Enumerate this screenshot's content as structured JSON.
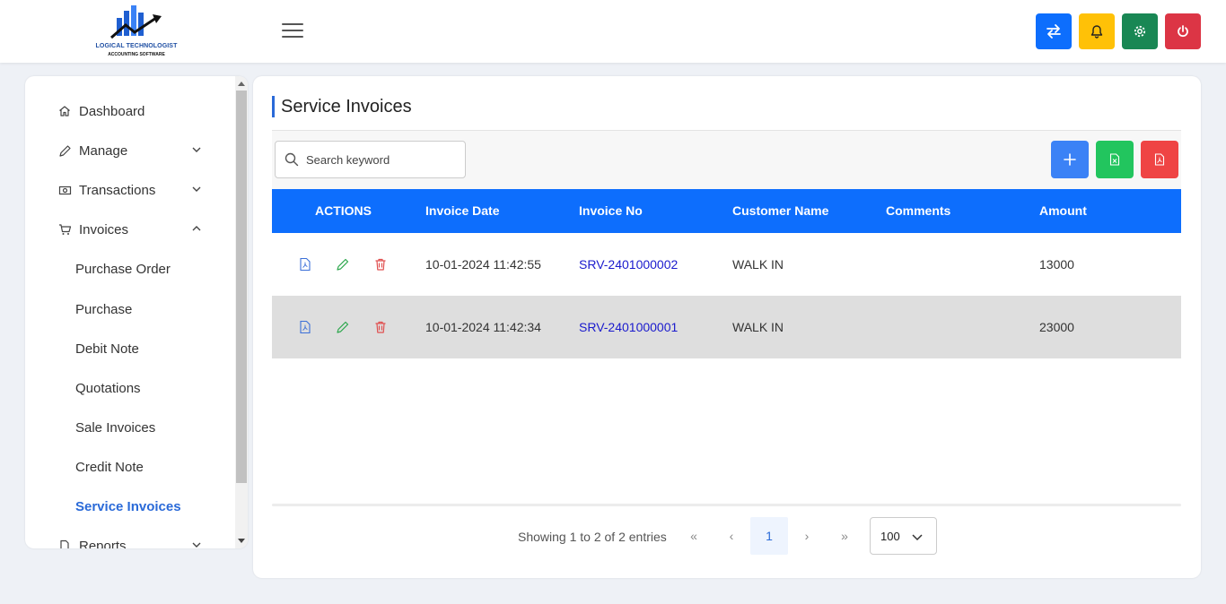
{
  "header": {
    "logo_brand": "LOGICAL TECHNOLOGIST",
    "logo_sub": "ACCOUNTING SOFTWARE",
    "buttons": [
      {
        "name": "switch",
        "icon": "arrows-exchange-icon",
        "color": "#0d6efd"
      },
      {
        "name": "notifications",
        "icon": "bell-icon",
        "color": "#ffc107"
      },
      {
        "name": "settings",
        "icon": "gear-icon",
        "color": "#198754"
      },
      {
        "name": "logout",
        "icon": "power-icon",
        "color": "#dc3545"
      }
    ]
  },
  "sidebar": {
    "items": [
      {
        "label": "Dashboard",
        "icon": "home-icon"
      },
      {
        "label": "Manage",
        "icon": "pencil-icon",
        "expand": "down"
      },
      {
        "label": "Transactions",
        "icon": "cash-icon",
        "expand": "down"
      },
      {
        "label": "Invoices",
        "icon": "cart-icon",
        "expand": "up"
      },
      {
        "label": "Reports",
        "icon": "document-icon",
        "expand": "down"
      }
    ],
    "subitems": [
      "Purchase Order",
      "Purchase",
      "Debit Note",
      "Quotations",
      "Sale Invoices",
      "Credit Note",
      "Service Invoices"
    ],
    "active_subitem": "Service Invoices"
  },
  "main": {
    "title": "Service Invoices",
    "search": {
      "placeholder": "Search keyword",
      "value": ""
    },
    "action_buttons": [
      {
        "name": "add",
        "icon": "plus-icon",
        "color": "#3b82f6"
      },
      {
        "name": "export-excel",
        "icon": "excel-file-icon",
        "color": "#22c55e"
      },
      {
        "name": "export-pdf",
        "icon": "pdf-file-icon",
        "color": "#ef4444"
      }
    ],
    "table": {
      "headers": [
        "ACTIONS",
        "Invoice Date",
        "Invoice No",
        "Customer Name",
        "Comments",
        "Amount"
      ],
      "rows": [
        {
          "date": "10-01-2024 11:42:55",
          "invoice_no": "SRV-2401000002",
          "customer": "WALK IN",
          "comments": "",
          "amount": "13000"
        },
        {
          "date": "10-01-2024 11:42:34",
          "invoice_no": "SRV-2401000001",
          "customer": "WALK IN",
          "comments": "",
          "amount": "23000"
        }
      ]
    },
    "pagination": {
      "showing": "Showing 1 to 2 of 2 entries",
      "first": "«",
      "prev": "‹",
      "current_page": "1",
      "next": "›",
      "last": "»",
      "per_page": "100"
    }
  },
  "colors": {
    "primary": "#0d6efd",
    "accent_blue": "#2a6ad8",
    "header_row": "#0d6efd",
    "row_alt": "#dedede",
    "link": "#1a1acd"
  }
}
